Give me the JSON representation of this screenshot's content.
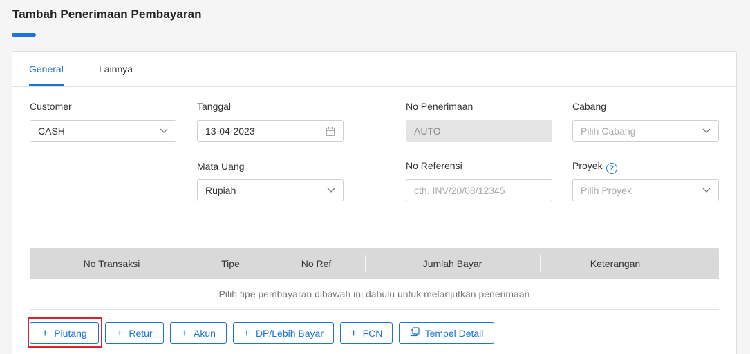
{
  "page": {
    "title": "Tambah Penerimaan Pembayaran"
  },
  "tabs": [
    {
      "label": "General"
    },
    {
      "label": "Lainnya"
    }
  ],
  "form": {
    "customer": {
      "label": "Customer",
      "value": "CASH"
    },
    "tanggal": {
      "label": "Tanggal",
      "value": "13-04-2023"
    },
    "no_penerimaan": {
      "label": "No Penerimaan",
      "value": "AUTO"
    },
    "cabang": {
      "label": "Cabang",
      "placeholder": "Pilih Cabang"
    },
    "mata_uang": {
      "label": "Mata Uang",
      "value": "Rupiah"
    },
    "no_referensi": {
      "label": "No Referensi",
      "placeholder": "cth. INV/20/08/12345"
    },
    "proyek": {
      "label": "Proyek",
      "placeholder": "Pilih Proyek",
      "help_icon": "?"
    }
  },
  "table": {
    "columns": [
      "No Transaksi",
      "Tipe",
      "No Ref",
      "Jumlah Bayar",
      "Keterangan"
    ],
    "empty_message": "Pilih tipe pembayaran dibawah ini dahulu untuk melanjutkan penerimaan"
  },
  "buttons": {
    "piutang": "Piutang",
    "retur": "Retur",
    "akun": "Akun",
    "dp_lebih_bayar": "DP/Lebih Bayar",
    "fcn": "FCN",
    "tempel_detail": "Tempel Detail"
  },
  "colors": {
    "accent": "#1a73d9",
    "highlight": "#d9232d"
  }
}
